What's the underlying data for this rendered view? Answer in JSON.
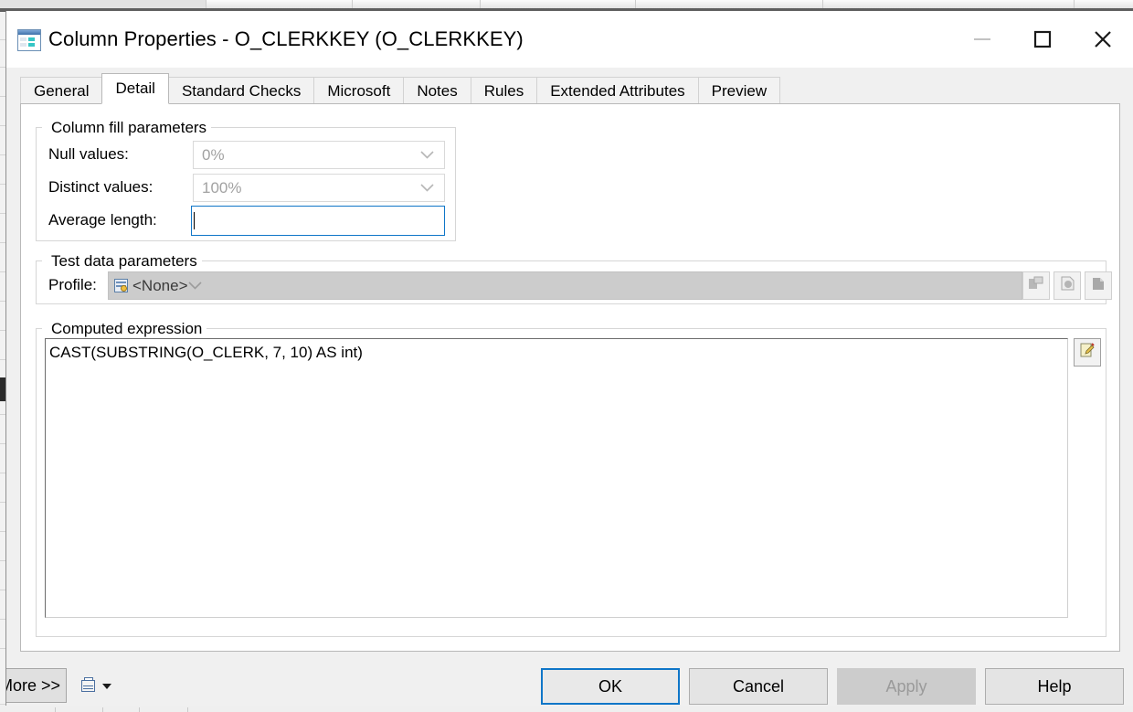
{
  "window": {
    "title": "Column Properties - O_CLERKKEY (O_CLERKKEY)",
    "icon": "table-grid-icon",
    "controls": {
      "minimize_label": "Minimize",
      "maximize_label": "Maximize",
      "close_label": "Close"
    }
  },
  "tabs": [
    {
      "label": "General",
      "active": false
    },
    {
      "label": "Detail",
      "active": true
    },
    {
      "label": "Standard Checks",
      "active": false
    },
    {
      "label": "Microsoft",
      "active": false
    },
    {
      "label": "Notes",
      "active": false
    },
    {
      "label": "Rules",
      "active": false
    },
    {
      "label": "Extended Attributes",
      "active": false
    },
    {
      "label": "Preview",
      "active": false
    }
  ],
  "column_fill": {
    "group_title": "Column fill parameters",
    "null_values": {
      "label": "Null values:",
      "value": "0%",
      "enabled": false
    },
    "distinct_values": {
      "label": "Distinct values:",
      "value": "100%",
      "enabled": false
    },
    "average_length": {
      "label": "Average length:",
      "value": "",
      "focused": true
    }
  },
  "test_data": {
    "group_title": "Test data parameters",
    "profile": {
      "label": "Profile:",
      "value": "<None>",
      "icon": "profile-grid-icon",
      "enabled": false
    },
    "buttons": [
      {
        "name": "new-profile-button",
        "icon": "new-page-icon",
        "enabled": false
      },
      {
        "name": "edit-profile-button",
        "icon": "edit-page-icon",
        "enabled": false
      },
      {
        "name": "delete-profile-button",
        "icon": "remove-page-icon",
        "enabled": false
      }
    ]
  },
  "computed_expression": {
    "group_title": "Computed expression",
    "value": "CAST(SUBSTRING(O_CLERK, 7, 10) AS int)",
    "edit_button": {
      "name": "edit-expression-button",
      "icon": "pencil-edit-icon",
      "enabled": true
    }
  },
  "footer": {
    "more_label": "More >>",
    "print_icon": "print-report-icon",
    "print_dropdown_icon": "caret-down-icon",
    "buttons": [
      {
        "label": "OK",
        "state": "focused"
      },
      {
        "label": "Cancel",
        "state": "normal"
      },
      {
        "label": "Apply",
        "state": "disabled"
      },
      {
        "label": "Help",
        "state": "normal"
      }
    ]
  },
  "colors": {
    "accent": "#0f76c8",
    "dialog_bg": "#f0f0f0",
    "panel_bg": "#ffffff",
    "disabled_text": "#9a9a9a",
    "disabled_bg": "#cccccc"
  }
}
